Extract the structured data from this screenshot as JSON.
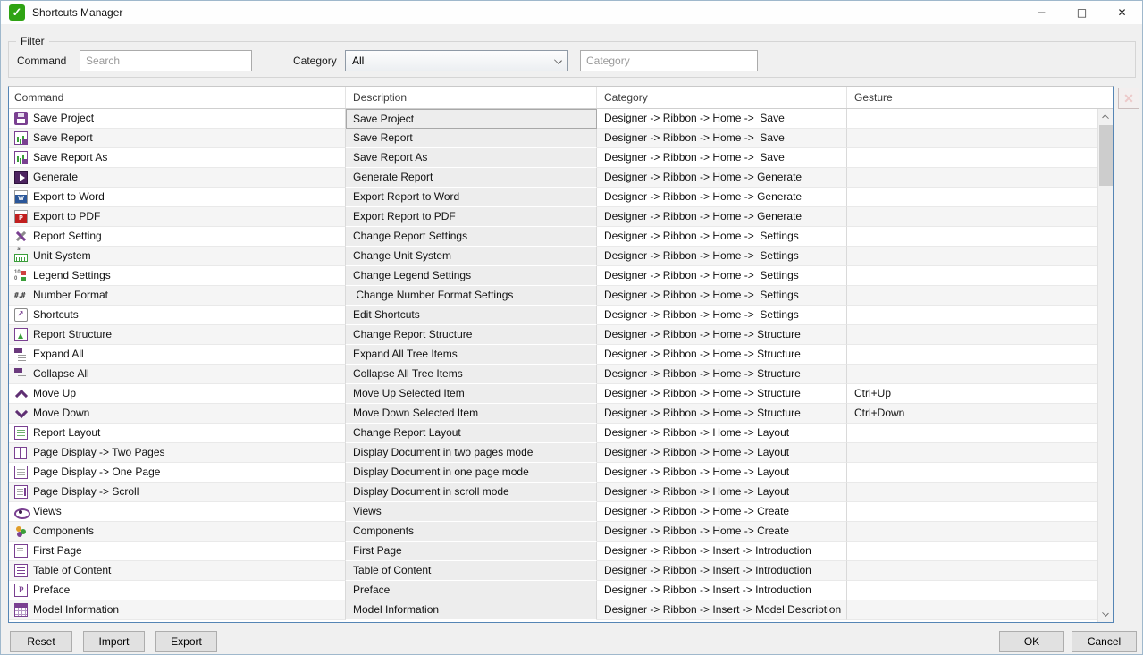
{
  "window": {
    "title": "Shortcuts Manager",
    "app_icon_glyph": "✓",
    "controls": {
      "minimize": "−",
      "maximize": "□",
      "close": "✕"
    }
  },
  "filter": {
    "group_label": "Filter",
    "command_label": "Command",
    "search_placeholder": "Search",
    "category_label": "Category",
    "category_value": "All",
    "category_placeholder": "Category"
  },
  "table": {
    "columns": [
      "Command",
      "Description",
      "Category",
      "Gesture"
    ],
    "delete_button_glyph": "✕",
    "rows": [
      {
        "icon": "save-project",
        "command": "Save Project",
        "description": "Save Project",
        "category": "Designer -> Ribbon -> Home ->  Save",
        "gesture": ""
      },
      {
        "icon": "save-report",
        "command": "Save Report",
        "description": "Save Report",
        "category": "Designer -> Ribbon -> Home ->  Save",
        "gesture": ""
      },
      {
        "icon": "save-report-as",
        "command": "Save Report As",
        "description": "Save Report As",
        "category": "Designer -> Ribbon -> Home ->  Save",
        "gesture": ""
      },
      {
        "icon": "generate",
        "command": "Generate",
        "description": "Generate Report",
        "category": "Designer -> Ribbon -> Home -> Generate",
        "gesture": ""
      },
      {
        "icon": "export-word",
        "command": "Export to Word",
        "description": "Export Report to Word",
        "category": "Designer -> Ribbon -> Home -> Generate",
        "gesture": ""
      },
      {
        "icon": "export-pdf",
        "command": "Export to PDF",
        "description": "Export Report to PDF",
        "category": "Designer -> Ribbon -> Home -> Generate",
        "gesture": ""
      },
      {
        "icon": "report-setting",
        "command": "Report Setting",
        "description": "Change Report Settings",
        "category": "Designer -> Ribbon -> Home ->  Settings",
        "gesture": ""
      },
      {
        "icon": "unit-system",
        "command": "Unit System",
        "description": "Change Unit System",
        "category": "Designer -> Ribbon -> Home ->  Settings",
        "gesture": ""
      },
      {
        "icon": "legend-settings",
        "command": "Legend Settings",
        "description": "Change Legend Settings",
        "category": "Designer -> Ribbon -> Home ->  Settings",
        "gesture": ""
      },
      {
        "icon": "number-format",
        "command": "Number Format",
        "description": " Change Number Format Settings",
        "category": "Designer -> Ribbon -> Home ->  Settings",
        "gesture": ""
      },
      {
        "icon": "shortcuts",
        "command": "Shortcuts",
        "description": "Edit Shortcuts",
        "category": "Designer -> Ribbon -> Home ->  Settings",
        "gesture": ""
      },
      {
        "icon": "report-structure",
        "command": "Report Structure",
        "description": "Change Report Structure",
        "category": "Designer -> Ribbon -> Home -> Structure",
        "gesture": ""
      },
      {
        "icon": "expand-all",
        "command": "Expand All",
        "description": "Expand All Tree Items",
        "category": "Designer -> Ribbon -> Home -> Structure",
        "gesture": ""
      },
      {
        "icon": "collapse-all",
        "command": "Collapse All",
        "description": "Collapse All Tree Items",
        "category": "Designer -> Ribbon -> Home -> Structure",
        "gesture": ""
      },
      {
        "icon": "move-up",
        "command": "Move Up",
        "description": "Move Up Selected Item",
        "category": "Designer -> Ribbon -> Home -> Structure",
        "gesture": "Ctrl+Up"
      },
      {
        "icon": "move-down",
        "command": "Move Down",
        "description": "Move Down Selected Item",
        "category": "Designer -> Ribbon -> Home -> Structure",
        "gesture": "Ctrl+Down"
      },
      {
        "icon": "report-layout",
        "command": "Report Layout",
        "description": "Change Report Layout",
        "category": "Designer -> Ribbon -> Home -> Layout",
        "gesture": ""
      },
      {
        "icon": "page-two",
        "command": "Page Display -> Two Pages",
        "description": "Display Document in two pages mode",
        "category": "Designer -> Ribbon -> Home -> Layout",
        "gesture": ""
      },
      {
        "icon": "page-one",
        "command": "Page Display -> One Page",
        "description": "Display Document in one page mode",
        "category": "Designer -> Ribbon -> Home -> Layout",
        "gesture": ""
      },
      {
        "icon": "page-scroll",
        "command": "Page Display -> Scroll",
        "description": "Display Document in scroll mode",
        "category": "Designer -> Ribbon -> Home -> Layout",
        "gesture": ""
      },
      {
        "icon": "views",
        "command": "Views",
        "description": "Views",
        "category": "Designer -> Ribbon -> Home -> Create",
        "gesture": ""
      },
      {
        "icon": "components",
        "command": "Components",
        "description": "Components",
        "category": "Designer -> Ribbon -> Home -> Create",
        "gesture": ""
      },
      {
        "icon": "first-page",
        "command": "First Page",
        "description": "First Page",
        "category": "Designer -> Ribbon -> Insert -> Introduction",
        "gesture": ""
      },
      {
        "icon": "toc",
        "command": "Table of Content",
        "description": "Table of Content",
        "category": "Designer -> Ribbon -> Insert -> Introduction",
        "gesture": ""
      },
      {
        "icon": "preface",
        "command": "Preface",
        "description": "Preface",
        "category": "Designer -> Ribbon -> Insert -> Introduction",
        "gesture": ""
      },
      {
        "icon": "model-information",
        "command": "Model Information",
        "description": "Model Information",
        "category": "Designer -> Ribbon -> Insert -> Model Description",
        "gesture": ""
      }
    ]
  },
  "buttons": {
    "reset": "Reset",
    "import": "Import",
    "export": "Export",
    "ok": "OK",
    "cancel": "Cancel"
  },
  "colors": {
    "accent_purple": "#7a4091",
    "app_icon_green": "#2fa313",
    "table_border_blue": "#5585b5",
    "word_blue": "#2b579a",
    "pdf_red": "#c11e1e"
  }
}
